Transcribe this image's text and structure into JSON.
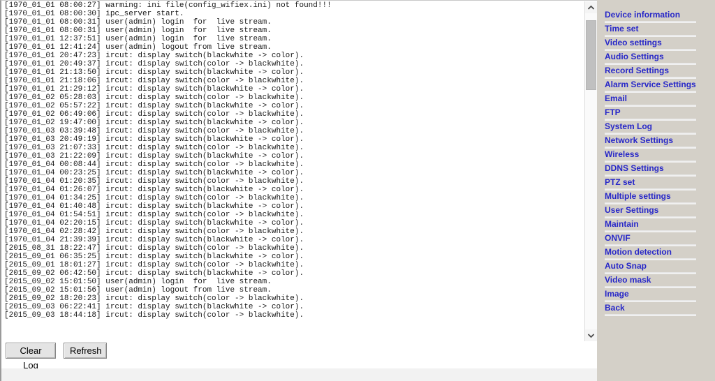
{
  "log": {
    "lines": [
      "[1970_01_01 08:00:27] warming: ini file(config_wifiex.ini) not found!!!",
      "[1970_01_01 08:00:30] ipc_server start.",
      "[1970_01_01 08:00:31] user(admin) login  for  live stream.",
      "[1970_01_01 08:00:31] user(admin) login  for  live stream.",
      "[1970_01_01 12:37:51] user(admin) login  for  live stream.",
      "[1970_01_01 12:41:24] user(admin) logout from live stream.",
      "[1970_01_01 20:47:23] ircut: display switch(blackwhite -> color).",
      "[1970_01_01 20:49:37] ircut: display switch(color -> blackwhite).",
      "[1970_01_01 21:13:50] ircut: display switch(blackwhite -> color).",
      "[1970_01_01 21:18:06] ircut: display switch(color -> blackwhite).",
      "[1970_01_01 21:29:12] ircut: display switch(blackwhite -> color).",
      "[1970_01_02 05:28:03] ircut: display switch(color -> blackwhite).",
      "[1970_01_02 05:57:22] ircut: display switch(blackwhite -> color).",
      "[1970_01_02 06:49:06] ircut: display switch(color -> blackwhite).",
      "[1970_01_02 19:47:00] ircut: display switch(blackwhite -> color).",
      "[1970_01_03 03:39:48] ircut: display switch(color -> blackwhite).",
      "[1970_01_03 20:49:19] ircut: display switch(blackwhite -> color).",
      "[1970_01_03 21:07:33] ircut: display switch(color -> blackwhite).",
      "[1970_01_03 21:22:09] ircut: display switch(blackwhite -> color).",
      "[1970_01_04 00:08:44] ircut: display switch(color -> blackwhite).",
      "[1970_01_04 00:23:25] ircut: display switch(blackwhite -> color).",
      "[1970_01_04 01:20:35] ircut: display switch(color -> blackwhite).",
      "[1970_01_04 01:26:07] ircut: display switch(blackwhite -> color).",
      "[1970_01_04 01:34:25] ircut: display switch(color -> blackwhite).",
      "[1970_01_04 01:40:48] ircut: display switch(blackwhite -> color).",
      "[1970_01_04 01:54:51] ircut: display switch(color -> blackwhite).",
      "[1970_01_04 02:20:15] ircut: display switch(blackwhite -> color).",
      "[1970_01_04 02:28:42] ircut: display switch(color -> blackwhite).",
      "[1970_01_04 21:39:39] ircut: display switch(blackwhite -> color).",
      "[2015_08_31 18:22:47] ircut: display switch(color -> blackwhite).",
      "[2015_09_01 06:35:25] ircut: display switch(blackwhite -> color).",
      "[2015_09_01 18:01:27] ircut: display switch(color -> blackwhite).",
      "[2015_09_02 06:42:50] ircut: display switch(blackwhite -> color).",
      "[2015_09_02 15:01:50] user(admin) login  for  live stream.",
      "[2015_09_02 15:01:56] user(admin) logout from live stream.",
      "[2015_09_02 18:20:23] ircut: display switch(color -> blackwhite).",
      "[2015_09_03 06:22:41] ircut: display switch(blackwhite -> color).",
      "[2015_09_03 18:44:18] ircut: display switch(color -> blackwhite)."
    ]
  },
  "scrollbar": {
    "up_arrow": "chevron-up-icon",
    "down_arrow": "chevron-down-icon"
  },
  "buttons": {
    "clear_log": "Clear Log",
    "refresh": "Refresh"
  },
  "sidebar": {
    "items": [
      {
        "label": "Device information"
      },
      {
        "label": "Time set"
      },
      {
        "label": "Video settings"
      },
      {
        "label": "Audio Settings"
      },
      {
        "label": "Record Settings"
      },
      {
        "label": "Alarm Service Settings"
      },
      {
        "label": "Email"
      },
      {
        "label": "FTP"
      },
      {
        "label": "System Log"
      },
      {
        "label": "Network Settings"
      },
      {
        "label": "Wireless"
      },
      {
        "label": "DDNS Settings"
      },
      {
        "label": "PTZ set"
      },
      {
        "label": "Multiple settings"
      },
      {
        "label": "User Settings"
      },
      {
        "label": "Maintain"
      },
      {
        "label": "ONVIF"
      },
      {
        "label": "Motion detection"
      },
      {
        "label": "Auto Snap"
      },
      {
        "label": "Video mask"
      },
      {
        "label": "Image"
      },
      {
        "label": "Back"
      }
    ]
  },
  "colors": {
    "menu_link": "#2727c8",
    "sidebar_bg": "#d4d0c8",
    "log_bg": "#ffffff",
    "log_text": "#1a1a1a"
  }
}
